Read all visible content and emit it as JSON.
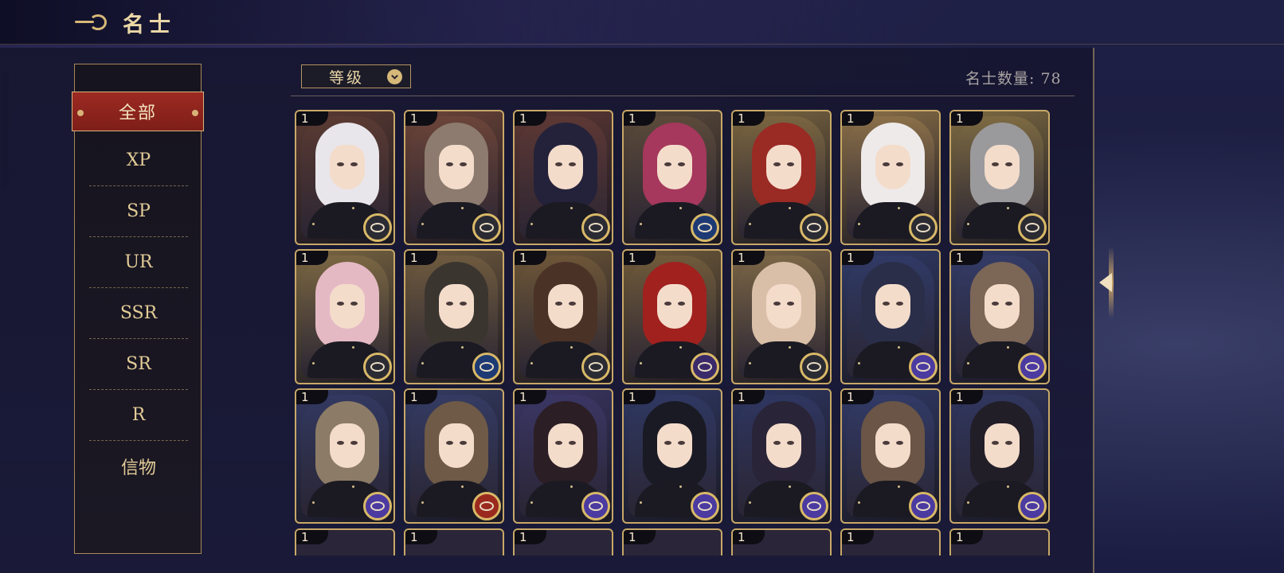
{
  "header": {
    "title": "名士"
  },
  "sidebar": {
    "items": [
      {
        "label": "全部",
        "selected": true
      },
      {
        "label": "XP"
      },
      {
        "label": "SP"
      },
      {
        "label": "UR"
      },
      {
        "label": "SSR"
      },
      {
        "label": "SR"
      },
      {
        "label": "R"
      },
      {
        "label": "信物"
      }
    ]
  },
  "toolbar": {
    "sort_label": "等级",
    "count_text": "名士数量: 78"
  },
  "colors": {
    "accent_red": "#8e241c",
    "gold": "#d6b878",
    "bg_navy": "#1b1d42"
  },
  "cards": [
    {
      "level": "1",
      "bg": "#5a3a32",
      "hair": "#e8e6ea",
      "emblem": "gray"
    },
    {
      "level": "1",
      "bg": "#6b4438",
      "hair": "#8c7b6e",
      "emblem": "gray"
    },
    {
      "level": "1",
      "bg": "#5d3834",
      "hair": "#24223a",
      "emblem": "gray"
    },
    {
      "level": "1",
      "bg": "#5b4a3a",
      "hair": "#a5385c",
      "emblem": "blue"
    },
    {
      "level": "1",
      "bg": "#7a6540",
      "hair": "#9a2a24",
      "emblem": "gray"
    },
    {
      "level": "1",
      "bg": "#8a6f48",
      "hair": "#eeeaea",
      "emblem": "gray"
    },
    {
      "level": "1",
      "bg": "#7d6a42",
      "hair": "#9a9a9c",
      "emblem": "gray"
    },
    {
      "level": "1",
      "bg": "#7a6642",
      "hair": "#e4b9c4",
      "emblem": "gray"
    },
    {
      "level": "1",
      "bg": "#6e5a3e",
      "hair": "#3b3530",
      "emblem": "blue"
    },
    {
      "level": "1",
      "bg": "#6d5638",
      "hair": "#4a3226",
      "emblem": "gray"
    },
    {
      "level": "1",
      "bg": "#6f5a3a",
      "hair": "#a0211e",
      "emblem": "purple"
    },
    {
      "level": "1",
      "bg": "#7a6546",
      "hair": "#d9bfa8",
      "emblem": "gray"
    },
    {
      "level": "1",
      "bg": "#303a66",
      "hair": "#2a2e48",
      "emblem": "orb"
    },
    {
      "level": "1",
      "bg": "#333b66",
      "hair": "#7c6656",
      "emblem": "orb"
    },
    {
      "level": "1",
      "bg": "#323860",
      "hair": "#8c7b66",
      "emblem": "orb"
    },
    {
      "level": "1",
      "bg": "#343b62",
      "hair": "#6e5a46",
      "emblem": "red"
    },
    {
      "level": "1",
      "bg": "#3a3664",
      "hair": "#2b1e24",
      "emblem": "orb"
    },
    {
      "level": "1",
      "bg": "#2f3862",
      "hair": "#1a1a24",
      "emblem": "orb"
    },
    {
      "level": "1",
      "bg": "#2e3660",
      "hair": "#2a2438",
      "emblem": "orb"
    },
    {
      "level": "1",
      "bg": "#313a66",
      "hair": "#6a5546",
      "emblem": "orb"
    },
    {
      "level": "1",
      "bg": "#30365e",
      "hair": "#221e28",
      "emblem": "orb"
    }
  ],
  "partial_row_levels": [
    "1",
    "1",
    "1",
    "1",
    "1",
    "1",
    "1"
  ]
}
